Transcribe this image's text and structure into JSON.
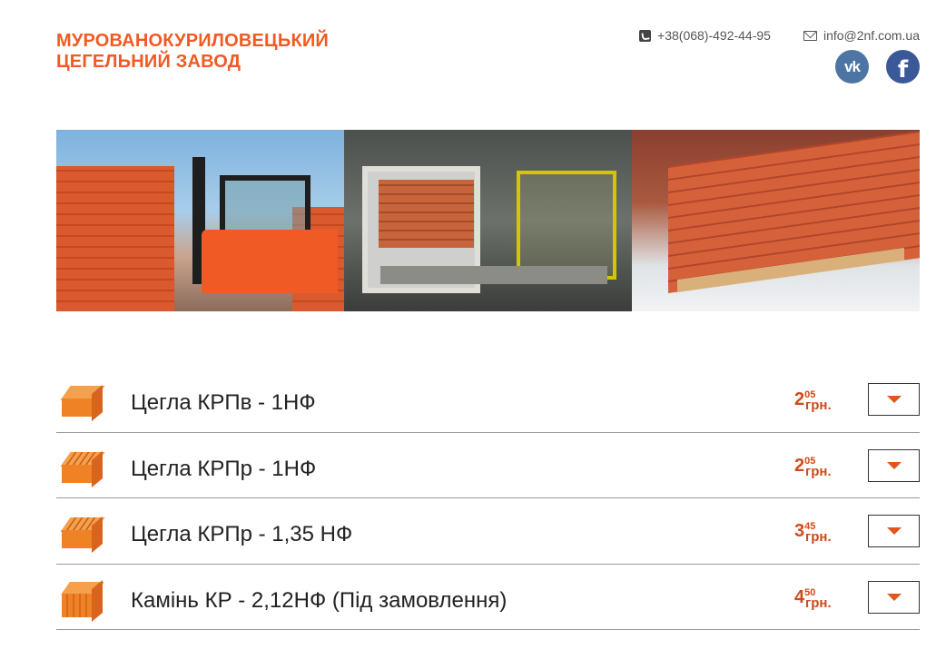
{
  "header": {
    "brand_line1": "МУРОВАНОКУРИЛОВЕЦЬКИЙ",
    "brand_line2": "ЦЕГЕЛЬНИЙ ЗАВОД",
    "phone": "+38(068)-492-44-95",
    "email": "info@2nf.com.ua",
    "social": {
      "vk_label": "vk",
      "fb_label": "f"
    }
  },
  "colors": {
    "accent": "#f05a24",
    "price": "#d04a1a",
    "vk": "#4c75a3",
    "facebook": "#3b5998"
  },
  "products": [
    {
      "name": "Цегла КРПв - 1НФ",
      "price_int": "2",
      "price_frac": "05",
      "currency": "грн.",
      "icon": "solid-brick-icon"
    },
    {
      "name": "Цегла КРПр - 1НФ",
      "price_int": "2",
      "price_frac": "05",
      "currency": "грн.",
      "icon": "hollow-brick-icon"
    },
    {
      "name": "Цегла КРПр - 1,35 НФ",
      "price_int": "3",
      "price_frac": "45",
      "currency": "грн.",
      "icon": "hollow-brick-icon"
    },
    {
      "name": "Камінь КР - 2,12НФ (Під замовлення)",
      "price_int": "4",
      "price_frac": "50",
      "currency": "грн.",
      "icon": "ceramic-block-icon"
    }
  ]
}
